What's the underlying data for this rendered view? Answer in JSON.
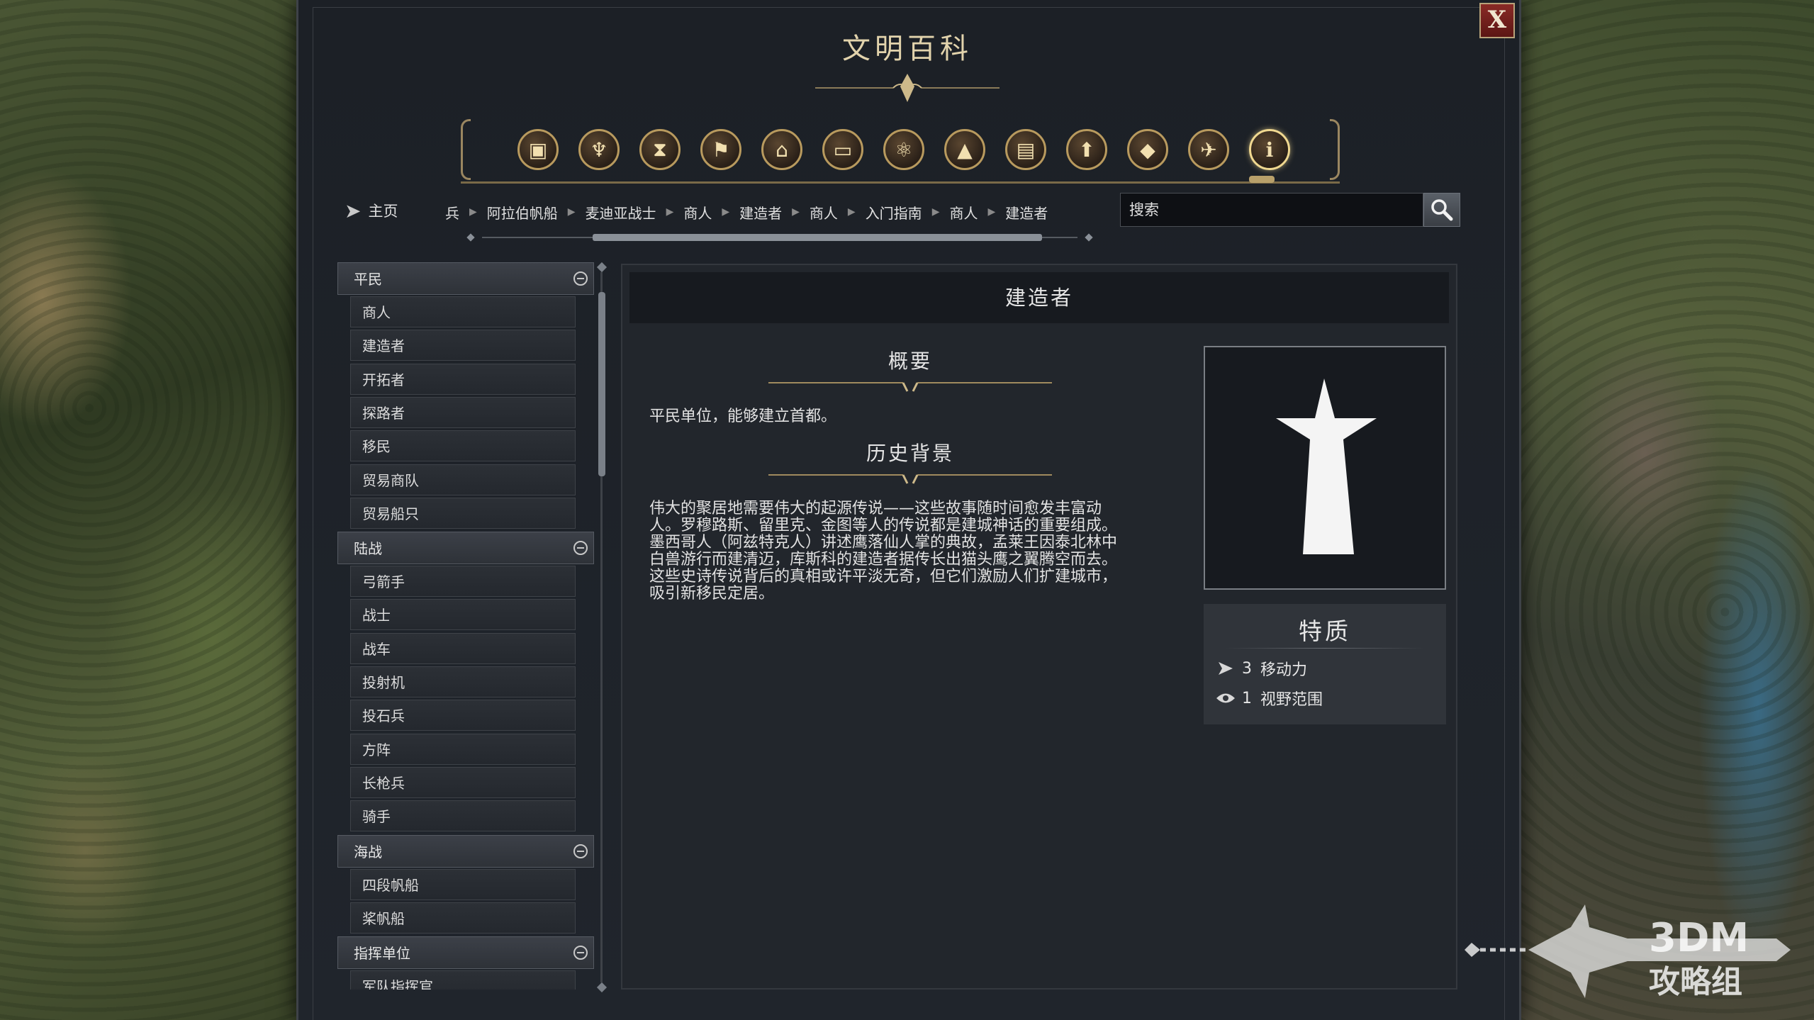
{
  "window": {
    "title": "文明百科",
    "close_label": "X"
  },
  "categories": [
    {
      "icon": "cube-icon"
    },
    {
      "icon": "chalice-icon"
    },
    {
      "icon": "hourglass-icon"
    },
    {
      "icon": "flag-icon"
    },
    {
      "icon": "temple-icon"
    },
    {
      "icon": "book-icon"
    },
    {
      "icon": "atom-icon"
    },
    {
      "icon": "mountain-icon"
    },
    {
      "icon": "building-icon"
    },
    {
      "icon": "arrow-up-icon"
    },
    {
      "icon": "diamond-icon"
    },
    {
      "icon": "dove-icon"
    },
    {
      "icon": "info-icon",
      "active": true
    }
  ],
  "nav": {
    "home_label": "主页",
    "breadcrumbs": [
      "兵",
      "阿拉伯帆船",
      "麦迪亚战士",
      "商人",
      "建造者",
      "商人",
      "入门指南",
      "商人",
      "建造者"
    ],
    "search_placeholder": "搜索"
  },
  "list": {
    "groups": [
      {
        "label": "平民",
        "items": [
          "商人",
          "建造者",
          "开拓者",
          "探路者",
          "移民",
          "贸易商队",
          "贸易船只"
        ]
      },
      {
        "label": "陆战",
        "items": [
          "弓箭手",
          "战士",
          "战车",
          "投射机",
          "投石兵",
          "方阵",
          "长枪兵",
          "骑手"
        ]
      },
      {
        "label": "海战",
        "items": [
          "四段帆船",
          "桨帆船"
        ]
      },
      {
        "label": "指挥单位",
        "items": [
          "军队指挥官"
        ]
      }
    ]
  },
  "detail": {
    "title": "建造者",
    "overview_heading": "概要",
    "overview_text": "平民单位，能够建立首都。",
    "history_heading": "历史背景",
    "history_lines": [
      "伟大的聚居地需要伟大的起源传说——这些故事随时间愈发丰富动",
      "人。罗穆路斯、留里克、金图等人的传说都是建城神话的重要组成。",
      "墨西哥人（阿兹特克人）讲述鹰落仙人掌的典故，孟莱王因泰北林中",
      "白兽游行而建清迈，库斯科的建造者据传长出猫头鹰之翼腾空而去。",
      "这些史诗传说背后的真相或许平淡无奇，但它们激励人们扩建城市，",
      "吸引新移民定居。"
    ],
    "traits": {
      "title": "特质",
      "rows": [
        {
          "icon": "movement-arrow-icon",
          "value": "3",
          "label": "移动力"
        },
        {
          "icon": "eye-icon",
          "value": "1",
          "label": "视野范围"
        }
      ]
    }
  },
  "watermark": {
    "line1": "3DM",
    "line2": "攻略组"
  },
  "colors": {
    "gold": "#b89a5e",
    "gold_light": "#e2d3ac",
    "panel": "#22262c",
    "close_red": "#8a2a26"
  }
}
